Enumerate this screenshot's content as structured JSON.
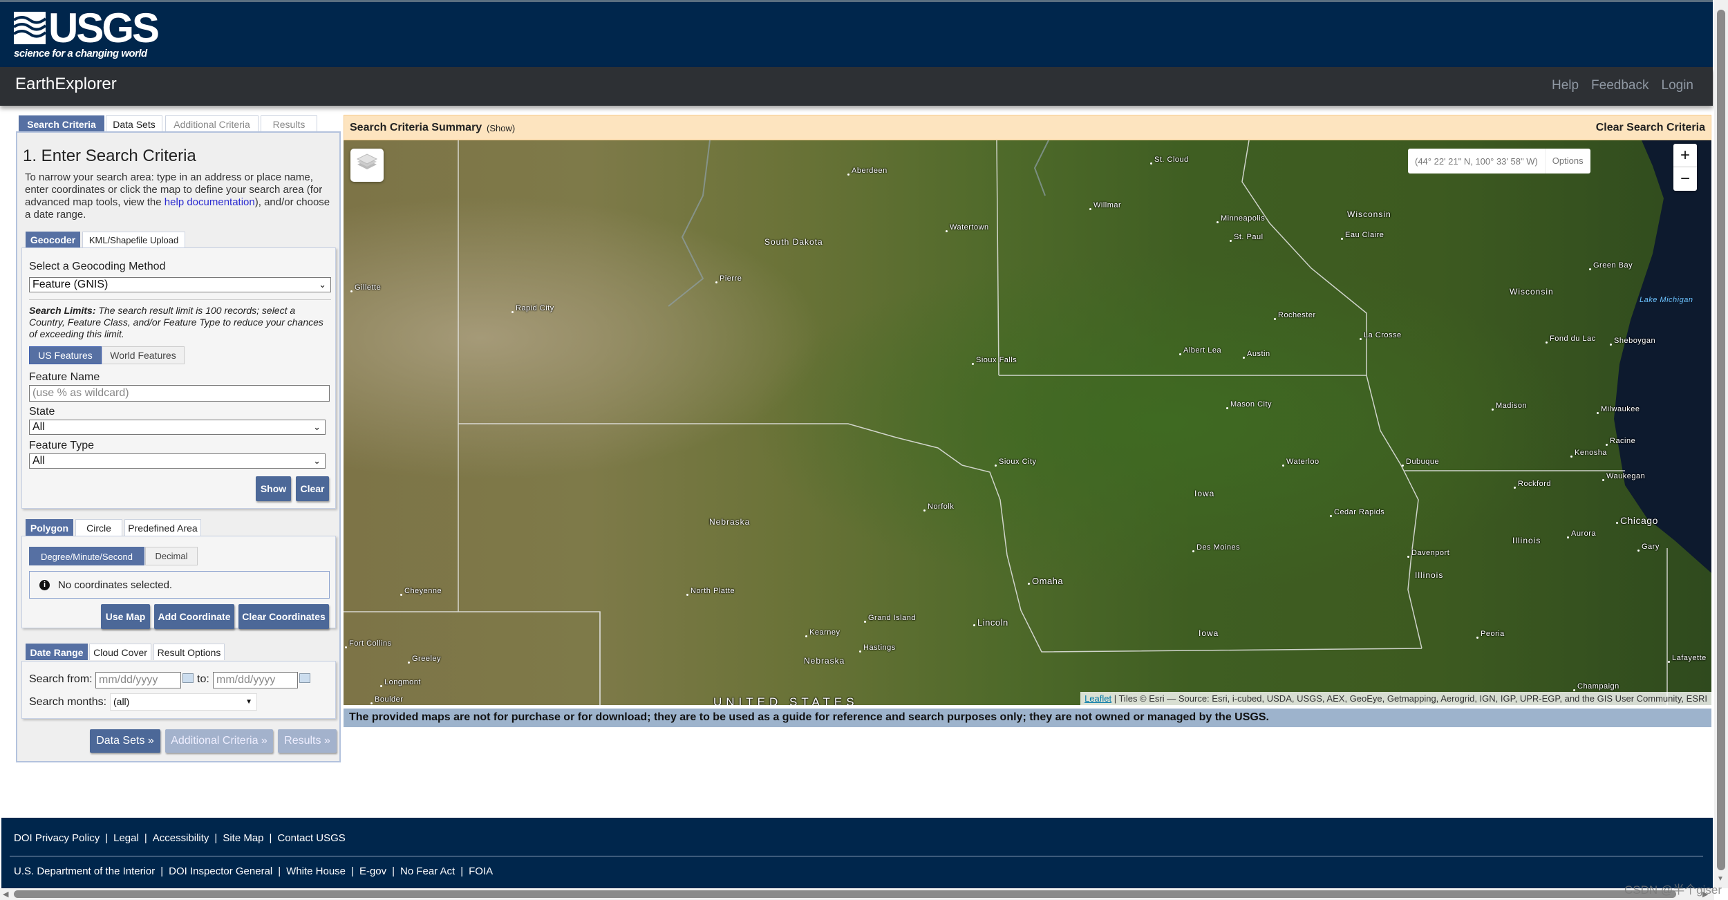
{
  "header": {
    "logo_text": "USGS",
    "tagline": "science for a changing world",
    "app_title": "EarthExplorer",
    "links": [
      "Help",
      "Feedback",
      "Login"
    ]
  },
  "left": {
    "tabs": [
      "Search Criteria",
      "Data Sets",
      "Additional Criteria",
      "Results"
    ],
    "title": "1. Enter Search Criteria",
    "intro_before": "To narrow your search area: type in an address or place name, enter coordinates or click the map to define your search area (for advanced map tools, view the ",
    "intro_link": "help documentation",
    "intro_after": "), and/or choose a date range.",
    "geo_tabs": [
      "Geocoder",
      "KML/Shapefile Upload"
    ],
    "method_label": "Select a Geocoding Method",
    "method_value": "Feature (GNIS)",
    "limits_bold": "Search Limits:",
    "limits_text": " The search result limit is 100 records; select a Country, Feature Class, and/or Feature Type to reduce your chances of exceeding this limit.",
    "feature_tabs": [
      "US Features",
      "World Features"
    ],
    "feature_name_label": "Feature Name",
    "feature_name_placeholder": "(use % as wildcard)",
    "state_label": "State",
    "state_value": "All",
    "type_label": "Feature Type",
    "type_value": "All",
    "show": "Show",
    "clear": "Clear",
    "area_tabs": [
      "Polygon",
      "Circle",
      "Predefined Area"
    ],
    "coord_tabs": [
      "Degree/Minute/Second",
      "Decimal"
    ],
    "no_coords": "No coordinates selected.",
    "use_map": "Use Map",
    "add_coord": "Add Coordinate",
    "clear_coords": "Clear Coordinates",
    "date_tabs": [
      "Date Range",
      "Cloud Cover",
      "Result Options"
    ],
    "from_label": "Search from:",
    "date_placeholder": "mm/dd/yyyy",
    "to_label": "to:",
    "months_label": "Search months:",
    "months_value": "(all)",
    "nav": [
      "Data Sets »",
      "Additional Criteria »",
      "Results »"
    ]
  },
  "summary": {
    "title": "Search Criteria Summary",
    "show": "(Show)",
    "clear": "Clear Search Criteria"
  },
  "map": {
    "coords": "(44° 22' 21\" N, 100° 33' 58\" W)",
    "options": "Options",
    "zoom_in": "+",
    "zoom_out": "−",
    "attrib_link": "Leaflet",
    "attrib_text": " | Tiles © Esri — Source: Esri, i-cubed, USDA, USGS, AEX, GeoEye, Getmapping, Aerogrid, IGN, IGP, UPR-EGP, and the GIS User Community, ESRI",
    "labels": [
      "St. Cloud",
      "Aberdeen",
      "Willmar",
      "Watertown",
      "South Dakota",
      "Minneapolis",
      "St. Paul",
      "Wisconsin",
      "Eau Claire",
      "Green Bay",
      "Pierre",
      "Gillette",
      "Rapid City",
      "Rochester",
      "Wisconsin",
      "Lake Michigan",
      "La Crosse",
      "Fond du Lac",
      "Sheboygan",
      "Sioux Falls",
      "Albert Lea",
      "Austin",
      "Mason City",
      "Madison",
      "Milwaukee",
      "Racine",
      "Kenosha",
      "Waukegan",
      "Sioux City",
      "Waterloo",
      "Dubuque",
      "Rockford",
      "Iowa",
      "Norfolk",
      "Nebraska",
      "Cedar Rapids",
      "Chicago",
      "Illinois",
      "Aurora",
      "Gary",
      "Des Moines",
      "Davenport",
      "Illinois",
      "Omaha",
      "Cheyenne",
      "North Platte",
      "Grand Island",
      "Lincoln",
      "Kearney",
      "Hastings",
      "Iowa",
      "Peoria",
      "Nebraska",
      "Fort Collins",
      "Greeley",
      "Longmont",
      "Boulder",
      "Champaign",
      "Lafayette",
      "UNITED STATES"
    ],
    "lake_color": "#0d1a2e"
  },
  "notice": "The provided maps are not for purchase or for download; they are to be used as a guide for reference and search purposes only; they are not owned or managed by the USGS.",
  "footer": {
    "row1": [
      "DOI Privacy Policy",
      "Legal",
      "Accessibility",
      "Site Map",
      "Contact USGS"
    ],
    "row2": [
      "U.S. Department of the Interior",
      "DOI Inspector General",
      "White House",
      "E-gov",
      "No Fear Act",
      "FOIA"
    ]
  },
  "watermark": "CSDN @半个giser",
  "colors": {
    "navy": "#00264c",
    "bar": "#2d3034",
    "accent": "#5670a3",
    "summary_bg": "#fde4bf",
    "notice_bg": "#9db3cc"
  }
}
